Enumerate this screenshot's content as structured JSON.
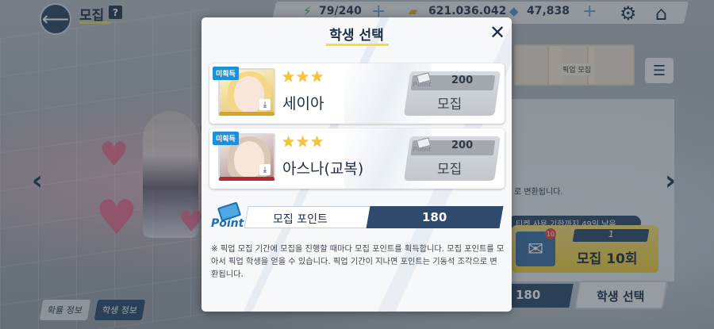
{
  "screen": {
    "title": "모집",
    "help_icon": "question-icon"
  },
  "resources": {
    "ap": "79/240",
    "credits": "621.036.042",
    "gems": "47,838"
  },
  "modal": {
    "title": "학생 선택",
    "characters": [
      {
        "badge": "미획득",
        "stars": 3,
        "stars_text": "★★★",
        "name": "세이아",
        "point_icon_text": "Point",
        "cost": "200",
        "button_label": "모집",
        "frame_color": "#d4a530"
      },
      {
        "badge": "미획득",
        "stars": 3,
        "stars_text": "★★★",
        "name": "아스나(교복)",
        "point_icon_text": "Point",
        "cost": "200",
        "button_label": "모집",
        "frame_color": "#b42a34"
      }
    ],
    "points": {
      "icon_text": "Point",
      "label": "모집 포인트",
      "value": "180"
    },
    "note": "※ 픽업 모집 기간에 모집을 진행할 때마다 모집 포인트를 획득합니다. 모집 포인트를 모아서 픽업 학생을 얻을 수 있습니다. 픽업 기간이 지나면 포인트는 기동석 조각으로 변환됩니다."
  },
  "background": {
    "right_text_1": "로 변환됩니다.",
    "ticket_notice": "티켓 사용 기한까지 49일 남음",
    "ticket_count_badge": "10",
    "ticket_count": "1",
    "recruit10_label": "모집 10회",
    "bottom_points": "180",
    "bottom_select_label": "학생 선택",
    "thumb_label": "픽업 모집",
    "tab_rates": "확률 정보",
    "tab_students": "학생 정보"
  },
  "colors": {
    "navy": "#2e4a6c",
    "accent_yellow": "#f3de38",
    "star": "#f4c534",
    "badge_blue": "#1f8fd8"
  }
}
